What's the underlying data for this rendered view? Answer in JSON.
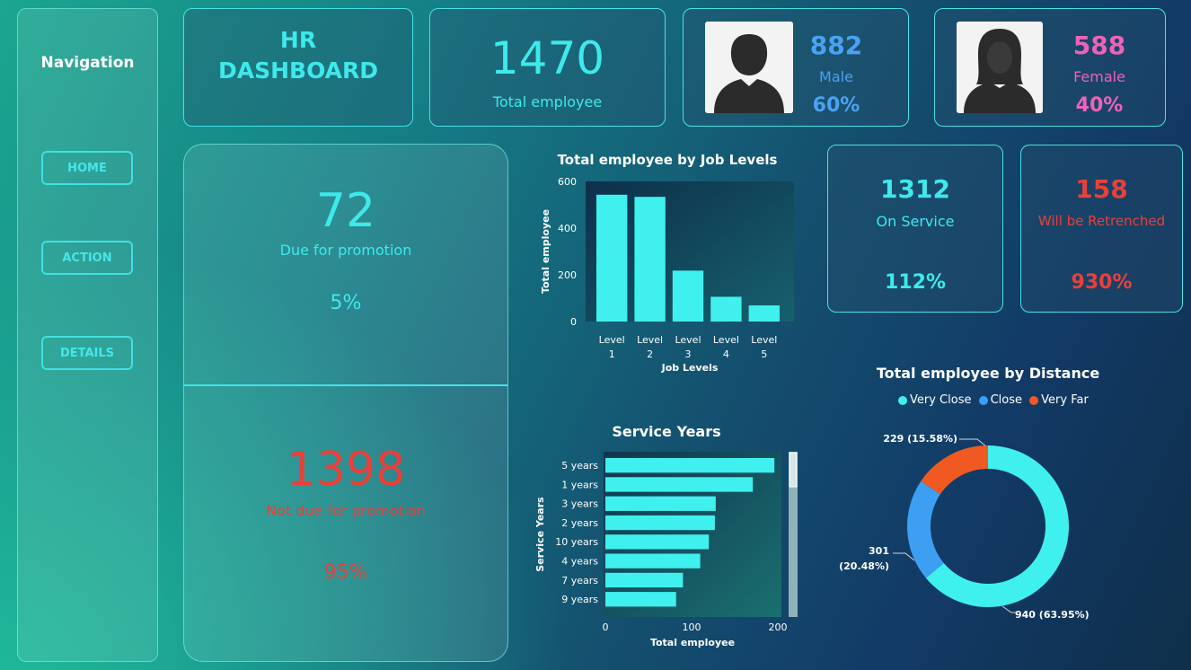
{
  "nav": {
    "title": "Navigation",
    "buttons": [
      {
        "label": "HOME"
      },
      {
        "label": "ACTION"
      },
      {
        "label": "DETAILS"
      }
    ]
  },
  "header": {
    "title_line1": "HR",
    "title_line2": "DASHBOARD"
  },
  "total": {
    "value": "1470",
    "label": "Total employee"
  },
  "male": {
    "value": "882",
    "label": "Male",
    "pct": "60%"
  },
  "female": {
    "value": "588",
    "label": "Female",
    "pct": "40%"
  },
  "promotion": {
    "due_value": "72",
    "due_label": "Due for promotion",
    "due_pct": "5%",
    "not_value": "1398",
    "not_label": "Not due for promotion",
    "not_pct": "95%"
  },
  "service": {
    "value": "1312",
    "label": "On Service",
    "pct": "112%"
  },
  "retrench": {
    "value": "158",
    "label": "Will be Retrenched",
    "pct": "930%"
  },
  "colors": {
    "accent": "#3ee9ea",
    "male": "#4aa2f5",
    "female": "#ee62b8",
    "red": "#e8403a",
    "bar": "#3ff0ee",
    "close": "#3e9ef2",
    "very_far": "#f05a22"
  },
  "chart_data": [
    {
      "type": "bar",
      "title": "Total employee by Job Levels",
      "xlabel": "Job Levels",
      "ylabel": "Total employee",
      "categories": [
        "Level 1",
        "Level 2",
        "Level 3",
        "Level 4",
        "Level 5"
      ],
      "values": [
        543,
        534,
        218,
        106,
        69
      ],
      "yticks": [
        0,
        200,
        400,
        600
      ],
      "ylim": [
        0,
        600
      ]
    },
    {
      "type": "bar",
      "orientation": "horizontal",
      "title": "Service Years",
      "xlabel": "Total employee",
      "ylabel": "Service Years",
      "categories": [
        "5 years",
        "1 years",
        "3 years",
        "2 years",
        "10 years",
        "4 years",
        "7 years",
        "9 years"
      ],
      "values": [
        196,
        171,
        128,
        127,
        120,
        110,
        90,
        82
      ],
      "xticks": [
        0,
        100,
        200
      ],
      "xlim": [
        0,
        200
      ]
    },
    {
      "type": "pie",
      "title": "Total employee by Distance",
      "legend": [
        "Very Close",
        "Close",
        "Very Far"
      ],
      "values": [
        940,
        301,
        229
      ],
      "labels": [
        "940 (63.95%)",
        "301",
        "(20.48%)",
        "229 (15.58%)"
      ]
    }
  ]
}
